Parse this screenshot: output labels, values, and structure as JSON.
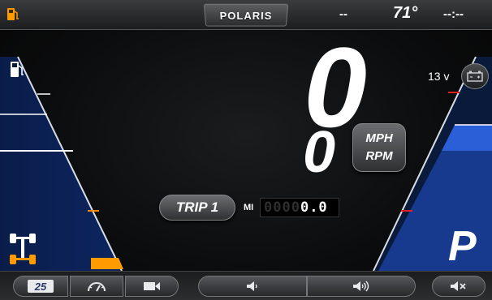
{
  "topbar": {
    "brand": "POLARIS",
    "status_dashes": "--",
    "temperature": "71°",
    "clock": "--:--"
  },
  "speed": {
    "value": "0",
    "rpm_value": "0",
    "unit_speed": "MPH",
    "unit_rpm": "RPM"
  },
  "voltage": "13 v",
  "trip": {
    "label": "TRIP 1",
    "unit": "MI",
    "odometer_dim": "0000",
    "odometer_lit": "0.0"
  },
  "gear": "P",
  "bottombar": {
    "days_badge": "25"
  },
  "colors": {
    "accent_blue": "#2a5fd8",
    "warning_orange": "#ff8c00",
    "marker_red": "#e02020"
  },
  "icons": {
    "fuel": "fuel-pump-icon",
    "battery": "battery-icon",
    "axle": "4wd-axle-icon",
    "gauge": "speedometer-icon",
    "camera": "video-camera-icon",
    "volume_down": "volume-down-icon",
    "volume_up": "volume-up-icon",
    "mute": "mute-icon"
  }
}
